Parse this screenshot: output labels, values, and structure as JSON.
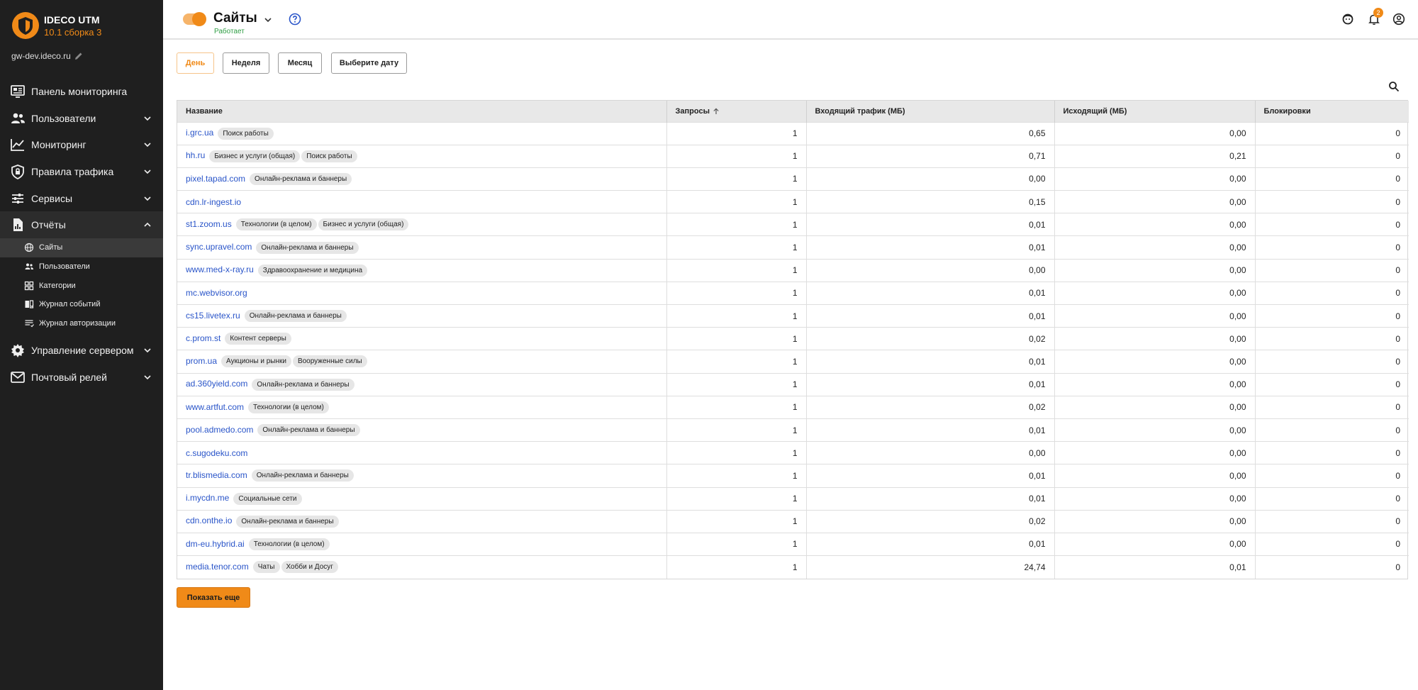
{
  "brand": {
    "name": "IDECO UTM",
    "version": "10.1 сборка 3",
    "host": "gw-dev.ideco.ru"
  },
  "nav": [
    {
      "label": "Панель мониторинга",
      "icon": "dashboard-icon",
      "chevron": false
    },
    {
      "label": "Пользователи",
      "icon": "users-icon",
      "chevron": true
    },
    {
      "label": "Мониторинг",
      "icon": "monitoring-icon",
      "chevron": true
    },
    {
      "label": "Правила трафика",
      "icon": "shield-lock-icon",
      "chevron": true
    },
    {
      "label": "Сервисы",
      "icon": "sliders-icon",
      "chevron": true
    },
    {
      "label": "Отчёты",
      "icon": "report-icon",
      "chevron": true,
      "open": true
    }
  ],
  "subnav": [
    {
      "label": "Сайты",
      "icon": "globe-icon",
      "active": true
    },
    {
      "label": "Пользователи",
      "icon": "users-icon"
    },
    {
      "label": "Категории",
      "icon": "grid-icon"
    },
    {
      "label": "Журнал событий",
      "icon": "event-log-icon"
    },
    {
      "label": "Журнал авторизации",
      "icon": "auth-log-icon"
    }
  ],
  "nav_bottom": [
    {
      "label": "Управление сервером",
      "icon": "gear-icon"
    },
    {
      "label": "Почтовый релей",
      "icon": "mail-icon"
    }
  ],
  "header": {
    "title": "Сайты",
    "status": "Работает",
    "notification_count": "2"
  },
  "periods": [
    "День",
    "Неделя",
    "Месяц",
    "Выберите дату"
  ],
  "table": {
    "columns": [
      "Название",
      "Запросы",
      "Входящий трафик (МБ)",
      "Исходящий (МБ)",
      "Блокировки"
    ],
    "rows": [
      {
        "site": "i.grc.ua",
        "tags": [
          "Поиск работы"
        ],
        "requests": "1",
        "in": "0,65",
        "out": "0,00",
        "blocks": "0"
      },
      {
        "site": "hh.ru",
        "tags": [
          "Бизнес и услуги (общая)",
          "Поиск работы"
        ],
        "requests": "1",
        "in": "0,71",
        "out": "0,21",
        "blocks": "0"
      },
      {
        "site": "pixel.tapad.com",
        "tags": [
          "Онлайн-реклама и баннеры"
        ],
        "requests": "1",
        "in": "0,00",
        "out": "0,00",
        "blocks": "0"
      },
      {
        "site": "cdn.lr-ingest.io",
        "tags": [],
        "requests": "1",
        "in": "0,15",
        "out": "0,00",
        "blocks": "0"
      },
      {
        "site": "st1.zoom.us",
        "tags": [
          "Технологии (в целом)",
          "Бизнес и услуги (общая)"
        ],
        "requests": "1",
        "in": "0,01",
        "out": "0,00",
        "blocks": "0"
      },
      {
        "site": "sync.upravel.com",
        "tags": [
          "Онлайн-реклама и баннеры"
        ],
        "requests": "1",
        "in": "0,01",
        "out": "0,00",
        "blocks": "0"
      },
      {
        "site": "www.med-x-ray.ru",
        "tags": [
          "Здравоохранение и медицина"
        ],
        "requests": "1",
        "in": "0,00",
        "out": "0,00",
        "blocks": "0"
      },
      {
        "site": "mc.webvisor.org",
        "tags": [],
        "requests": "1",
        "in": "0,01",
        "out": "0,00",
        "blocks": "0"
      },
      {
        "site": "cs15.livetex.ru",
        "tags": [
          "Онлайн-реклама и баннеры"
        ],
        "requests": "1",
        "in": "0,01",
        "out": "0,00",
        "blocks": "0"
      },
      {
        "site": "c.prom.st",
        "tags": [
          "Контент серверы"
        ],
        "requests": "1",
        "in": "0,02",
        "out": "0,00",
        "blocks": "0"
      },
      {
        "site": "prom.ua",
        "tags": [
          "Аукционы и рынки",
          "Вооруженные силы"
        ],
        "requests": "1",
        "in": "0,01",
        "out": "0,00",
        "blocks": "0"
      },
      {
        "site": "ad.360yield.com",
        "tags": [
          "Онлайн-реклама и баннеры"
        ],
        "requests": "1",
        "in": "0,01",
        "out": "0,00",
        "blocks": "0"
      },
      {
        "site": "www.artfut.com",
        "tags": [
          "Технологии (в целом)"
        ],
        "requests": "1",
        "in": "0,02",
        "out": "0,00",
        "blocks": "0"
      },
      {
        "site": "pool.admedo.com",
        "tags": [
          "Онлайн-реклама и баннеры"
        ],
        "requests": "1",
        "in": "0,01",
        "out": "0,00",
        "blocks": "0"
      },
      {
        "site": "c.sugodeku.com",
        "tags": [],
        "requests": "1",
        "in": "0,00",
        "out": "0,00",
        "blocks": "0"
      },
      {
        "site": "tr.blismedia.com",
        "tags": [
          "Онлайн-реклама и баннеры"
        ],
        "requests": "1",
        "in": "0,01",
        "out": "0,00",
        "blocks": "0"
      },
      {
        "site": "i.mycdn.me",
        "tags": [
          "Социальные сети"
        ],
        "requests": "1",
        "in": "0,01",
        "out": "0,00",
        "blocks": "0"
      },
      {
        "site": "cdn.onthe.io",
        "tags": [
          "Онлайн-реклама и баннеры"
        ],
        "requests": "1",
        "in": "0,02",
        "out": "0,00",
        "blocks": "0"
      },
      {
        "site": "dm-eu.hybrid.ai",
        "tags": [
          "Технологии (в целом)"
        ],
        "requests": "1",
        "in": "0,01",
        "out": "0,00",
        "blocks": "0"
      },
      {
        "site": "media.tenor.com",
        "tags": [
          "Чаты",
          "Хобби и Досуг"
        ],
        "requests": "1",
        "in": "24,74",
        "out": "0,01",
        "blocks": "0"
      }
    ]
  },
  "more_button": "Показать еще",
  "colors": {
    "accent": "#f08a18",
    "sidebar": "#1f1f1f",
    "link": "#2a55c9",
    "status": "#2f9e44"
  }
}
